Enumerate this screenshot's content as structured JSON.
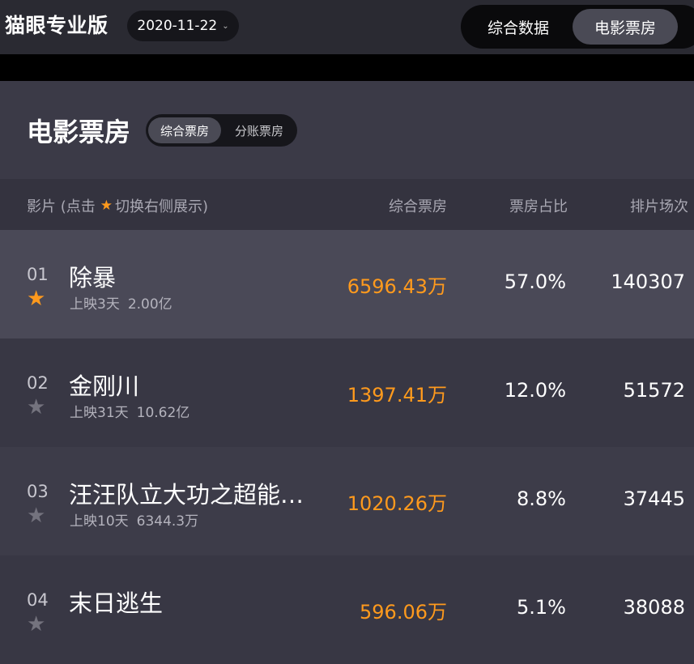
{
  "header": {
    "brand": "猫眼专业版",
    "date": "2020-11-22",
    "tabs": [
      "综合数据",
      "电影票房"
    ],
    "active_tab": "电影票房"
  },
  "section": {
    "title": "电影票房",
    "subtabs": [
      "综合票房",
      "分账票房"
    ],
    "active_subtab": "综合票房"
  },
  "columns": {
    "film_prefix": "影片 (点击",
    "film_suffix": "切换右侧展示)",
    "box": "综合票房",
    "share": "票房占比",
    "shows": "排片场次"
  },
  "colors": {
    "accent": "#ff9a1d",
    "star_off": "#74737e"
  },
  "rows": [
    {
      "rank": "01",
      "title": "除暴",
      "days": "上映3天",
      "total": "2.00亿",
      "box": "6596.43万",
      "share": "57.0%",
      "shows": "140307",
      "starred": true
    },
    {
      "rank": "02",
      "title": "金刚川",
      "days": "上映31天",
      "total": "10.62亿",
      "box": "1397.41万",
      "share": "12.0%",
      "shows": "51572",
      "starred": false
    },
    {
      "rank": "03",
      "title": "汪汪队立大功之超能…",
      "days": "上映10天",
      "total": "6344.3万",
      "box": "1020.26万",
      "share": "8.8%",
      "shows": "37445",
      "starred": false
    },
    {
      "rank": "04",
      "title": "末日逃生",
      "days": "",
      "total": "",
      "box": "596.06万",
      "share": "5.1%",
      "shows": "38088",
      "starred": false
    }
  ]
}
